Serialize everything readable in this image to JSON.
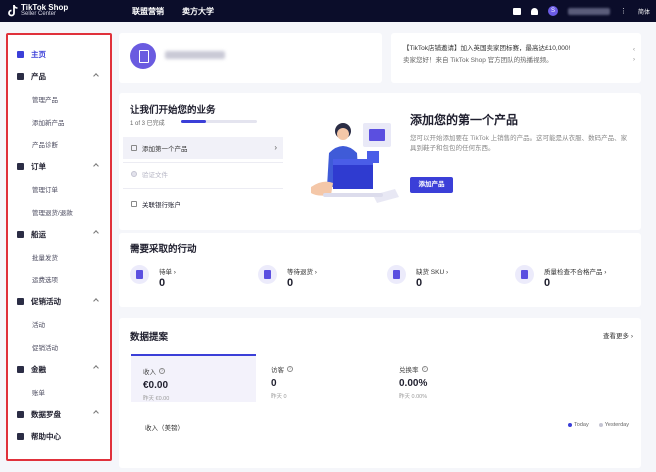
{
  "topbar": {
    "brand_line1": "TikTok Shop",
    "brand_line2": "Seller Center",
    "nav": [
      "联盟营销",
      "卖方大学"
    ],
    "lang": "简体"
  },
  "sidebar": {
    "items": [
      {
        "label": "主页",
        "type": "parent",
        "active": true,
        "icon": "home-icon"
      },
      {
        "label": "产品",
        "type": "parent",
        "expanded": true,
        "icon": "product-icon"
      },
      {
        "label": "管理产品",
        "type": "child"
      },
      {
        "label": "添加新产品",
        "type": "child"
      },
      {
        "label": "产品诊断",
        "type": "child"
      },
      {
        "label": "订单",
        "type": "parent",
        "expanded": true,
        "icon": "order-icon"
      },
      {
        "label": "管理订单",
        "type": "child"
      },
      {
        "label": "管理退货/退款",
        "type": "child"
      },
      {
        "label": "船运",
        "type": "parent",
        "expanded": true,
        "icon": "shipping-icon"
      },
      {
        "label": "批量发货",
        "type": "child"
      },
      {
        "label": "运费选项",
        "type": "child"
      },
      {
        "label": "促销活动",
        "type": "parent",
        "expanded": true,
        "icon": "promotion-icon"
      },
      {
        "label": "活动",
        "type": "child"
      },
      {
        "label": "促销活动",
        "type": "child"
      },
      {
        "label": "金融",
        "type": "parent",
        "expanded": true,
        "icon": "finance-icon"
      },
      {
        "label": "账单",
        "type": "child"
      },
      {
        "label": "数据罗盘",
        "type": "parent",
        "expanded": true,
        "icon": "data-compass-icon"
      },
      {
        "label": "帮助中心",
        "type": "parent",
        "icon": "help-icon"
      }
    ]
  },
  "notice": {
    "line1": "【TikTok店铺邀请】加入英国卖家团标赛，最高达£10,000!",
    "line2": "卖家您好！来自 TikTok Shop 官方团队的热播视频。"
  },
  "business": {
    "title": "让我们开始您的业务",
    "progress_text": "1 of 3 已完成",
    "progress": 0.33,
    "steps": [
      {
        "label": "添加第一个产品",
        "state": "active",
        "icon": "product-box-icon"
      },
      {
        "label": "验证文件",
        "state": "disabled",
        "icon": "check-circle-icon"
      },
      {
        "label": "关联银行账户",
        "state": "normal",
        "icon": "bank-icon"
      }
    ],
    "product_title": "添加您的第一个产品",
    "product_desc": "您可以开始添加要在 TikTok 上销售的产品。这可能是从衣服、数码产品、家具到鞋子和包包的任何东西。",
    "product_button": "添加产品"
  },
  "actions": {
    "title": "需要采取的行动",
    "items": [
      {
        "label": "待单 ›",
        "value": "0",
        "icon": "pending-order-icon"
      },
      {
        "label": "等待退货 ›",
        "value": "0",
        "icon": "return-icon"
      },
      {
        "label": "缺货 SKU ›",
        "value": "0",
        "icon": "out-of-stock-icon"
      },
      {
        "label": "质量检查不合格产品 ›",
        "value": "0",
        "icon": "quality-check-icon"
      }
    ]
  },
  "data_overview": {
    "title": "数据提案",
    "more": "查看更多 ›",
    "metrics": [
      {
        "label": "收入",
        "value": "€0.00",
        "sub": "昨天 €0.00",
        "active": true
      },
      {
        "label": "访客",
        "value": "0",
        "sub": "昨天 0",
        "active": false
      },
      {
        "label": "兑换率",
        "value": "0.00%",
        "sub": "昨天 0.00%",
        "active": false
      }
    ],
    "chart_label": "收入（美镑）",
    "legend": [
      {
        "label": "Today",
        "color": "#3b3fd8"
      },
      {
        "label": "Yesterday",
        "color": "#c5c5d3"
      }
    ]
  }
}
